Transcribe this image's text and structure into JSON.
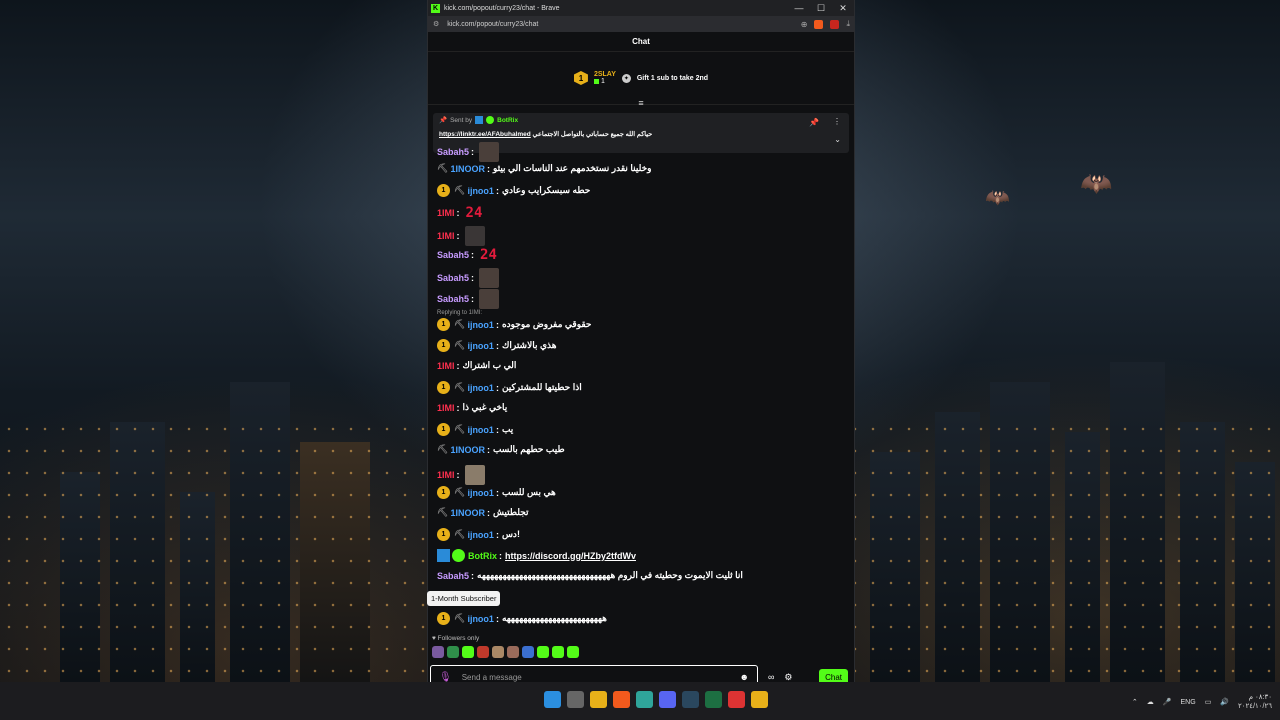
{
  "browser": {
    "title": "kick.com/popout/curry23/chat - Brave",
    "url": "kick.com/popout/curry23/chat",
    "minimize": "—",
    "maximize": "☐",
    "close": "✕"
  },
  "chat": {
    "header": "Chat",
    "leaderboard": {
      "rank": "1",
      "name": "2SLAY",
      "count": "1",
      "gift_cta": "Gift 1 sub to take 2nd"
    },
    "pinned": {
      "sent_by": "Sent by",
      "sender": "BotRix",
      "message": "حياكم الله جميع حساباتي بالتواصل الاجتماعي",
      "link": "https://linktr.ee/AFAbuhalmed"
    },
    "messages": [
      {
        "user": "Sabah5",
        "color": "#c79bff",
        "text": "",
        "emote": "a"
      },
      {
        "user": "1INOOR",
        "color": "#4aa3ff",
        "pick": true,
        "text": "وخلينا نقدر نستخدمهم عند الناسات الي بيثو"
      },
      {
        "user": "ijnoo1",
        "color": "#4aa3ff",
        "badge": "1",
        "pick": true,
        "text": "حطه سبسكرايب وعادي"
      },
      {
        "user": "1IMI",
        "color": "#ff2f4e",
        "text": "",
        "num": "24"
      },
      {
        "user": "1IMI",
        "color": "#ff2f4e",
        "text": "",
        "emote": "b"
      },
      {
        "user": "Sabah5",
        "color": "#c79bff",
        "text": "",
        "num": "24"
      },
      {
        "user": "Sabah5",
        "color": "#c79bff",
        "text": "",
        "emote": "a"
      },
      {
        "user": "Sabah5",
        "color": "#c79bff",
        "text": "",
        "emote": "a"
      },
      {
        "user": "ijnoo1",
        "color": "#4aa3ff",
        "badge": "1",
        "pick": true,
        "text": "حقوقي مفروض موجوده"
      },
      {
        "user": "ijnoo1",
        "color": "#4aa3ff",
        "badge": "1",
        "pick": true,
        "text": "هذي بالاشتراك"
      },
      {
        "user": "1IMI",
        "color": "#ff2f4e",
        "text": "الي ب اشتراك"
      },
      {
        "user": "ijnoo1",
        "color": "#4aa3ff",
        "badge": "1",
        "pick": true,
        "text": "اذا حطيتها للمشتركين"
      },
      {
        "user": "1IMI",
        "color": "#ff2f4e",
        "text": "ياخي غبي ذا"
      },
      {
        "user": "ijnoo1",
        "color": "#4aa3ff",
        "badge": "1",
        "pick": true,
        "text": "يب"
      },
      {
        "user": "1INOOR",
        "color": "#4aa3ff",
        "pick": true,
        "text": "طيب حطهم بالسب"
      },
      {
        "user": "1IMI",
        "color": "#ff2f4e",
        "text": "",
        "emote": "c"
      },
      {
        "user": "ijnoo1",
        "color": "#4aa3ff",
        "badge": "1",
        "pick": true,
        "text": "هي بس للسب"
      },
      {
        "user": "1INOOR",
        "color": "#4aa3ff",
        "pick": true,
        "text": "تجلطتيش"
      },
      {
        "user": "ijnoo1",
        "color": "#4aa3ff",
        "badge": "1",
        "pick": true,
        "text": "دس!"
      },
      {
        "user": "BotRix",
        "color": "#53fc18",
        "bot": true,
        "text": "https://discord.gg/HZby2tfdWv",
        "is_link": true
      },
      {
        "user": "Sabah5",
        "color": "#c79bff",
        "text": "انا ثليت الايموت وحطيته في الروم ههههههههههههههههههههههههههههههههه"
      },
      {
        "user": "ijnoo1",
        "color": "#4aa3ff",
        "badge": "1",
        "pick": true,
        "text": "ههههههههههههههههههههههههه"
      }
    ],
    "reply_label": "Replying to 1IMI:",
    "tooltip": "1-Month Subscriber",
    "followers_only": "Followers only",
    "input_placeholder": "Send a message",
    "send_label": "Chat"
  },
  "taskbar": {
    "lang": "ENG",
    "time": "٠٨:٣٠ م",
    "date": "٢٠٢٤/١٠/٢٦"
  },
  "colors": {
    "kick_green": "#53fc18",
    "gold": "#e7b019"
  }
}
